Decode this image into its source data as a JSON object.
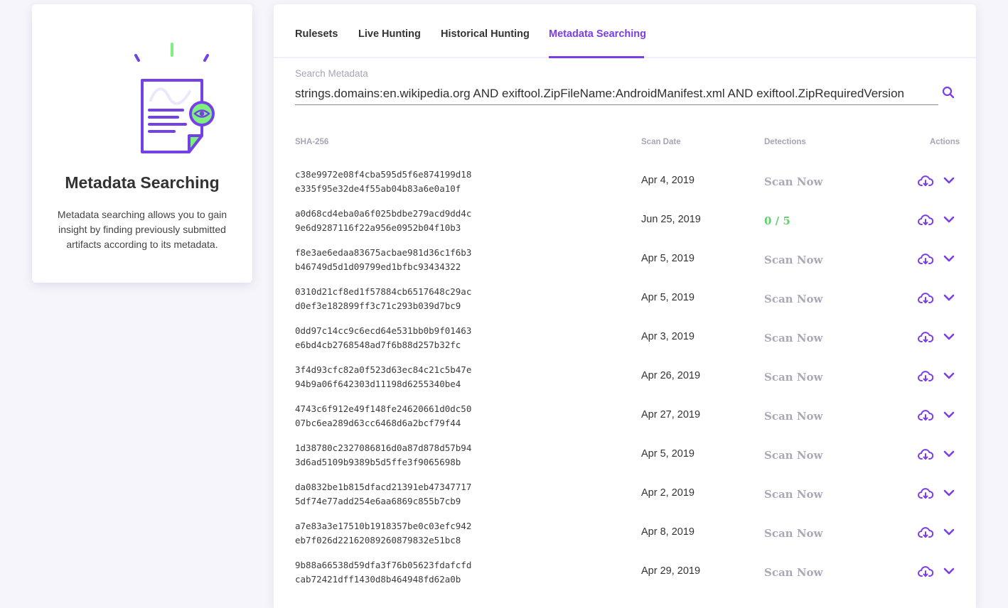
{
  "sidebar": {
    "title": "Metadata Searching",
    "description": "Metadata searching allows you to gain insight by finding previously submitted artifacts according to its metadata.",
    "illustration_icon": "document-eye-icon"
  },
  "tabs": [
    {
      "label": "Rulesets",
      "active": false
    },
    {
      "label": "Live Hunting",
      "active": false
    },
    {
      "label": "Historical Hunting",
      "active": false
    },
    {
      "label": "Metadata Searching",
      "active": true
    }
  ],
  "search": {
    "label": "Search Metadata",
    "value": "strings.domains:en.wikipedia.org AND exiftool.ZipFileName:AndroidManifest.xml AND exiftool.ZipRequiredVersion",
    "icon": "search-icon"
  },
  "table": {
    "headers": {
      "sha": "SHA-256",
      "date": "Scan Date",
      "detections": "Detections",
      "actions": "Actions"
    },
    "rows": [
      {
        "sha1": "c38e9972e08f4cba595d5f6e874199d18",
        "sha2": "e335f95e32de4f55ab04b83a6e0a10f",
        "date": "Apr 4, 2019",
        "detections": "Scan Now",
        "type": "scan"
      },
      {
        "sha1": "a0d68cd4eba0a6f025bdbe279acd9dd4c",
        "sha2": "9e6d9287116f22a956e0952b04f10b3",
        "date": "Jun 25, 2019",
        "detections": "0 / 5",
        "type": "score"
      },
      {
        "sha1": "f8e3ae6edaa83675acbae981d36c1f6b3",
        "sha2": "b46749d5d1d09799ed1bfbc93434322",
        "date": "Apr 5, 2019",
        "detections": "Scan Now",
        "type": "scan"
      },
      {
        "sha1": "0310d21cf8ed1f57884cb6517648c29ac",
        "sha2": "d0ef3e182899ff3c71c293b039d7bc9",
        "date": "Apr 5, 2019",
        "detections": "Scan Now",
        "type": "scan"
      },
      {
        "sha1": "0dd97c14cc9c6ecd64e531bb0b9f01463",
        "sha2": "e6bd4cb2768548ad7f6b88d257b32fc",
        "date": "Apr 3, 2019",
        "detections": "Scan Now",
        "type": "scan"
      },
      {
        "sha1": "3f4d93cfc82a0f523d63ec84c21c5b47e",
        "sha2": "94b9a06f642303d11198d6255340be4",
        "date": "Apr 26, 2019",
        "detections": "Scan Now",
        "type": "scan"
      },
      {
        "sha1": "4743c6f912e49f148fe24620661d0dc50",
        "sha2": "07bc6ea289d63cc6468d6a2bcf79f44",
        "date": "Apr 27, 2019",
        "detections": "Scan Now",
        "type": "scan"
      },
      {
        "sha1": "1d38780c2327086816d0a87d878d57b94",
        "sha2": "3d6ad5109b9389b5d5ffe3f9065698b",
        "date": "Apr 5, 2019",
        "detections": "Scan Now",
        "type": "scan"
      },
      {
        "sha1": "da0832be1b815dfacd21391eb47347717",
        "sha2": "5df74e77add254e6aa6869c855b7cb9",
        "date": "Apr 2, 2019",
        "detections": "Scan Now",
        "type": "scan"
      },
      {
        "sha1": "a7e83a3e17510b1918357be0c03efc942",
        "sha2": "eb7f026d22162089260879832e51bc8",
        "date": "Apr 8, 2019",
        "detections": "Scan Now",
        "type": "scan"
      },
      {
        "sha1": "9b88a66538d59dfa3f76b05623fdafcfd",
        "sha2": "cab72421dff1430d8b464948fd62a0b",
        "date": "Apr 29, 2019",
        "detections": "Scan Now",
        "type": "scan"
      }
    ],
    "row_actions": {
      "download": "cloud-download-icon",
      "expand": "chevron-down-icon"
    }
  },
  "colors": {
    "accent": "#7a3ee8",
    "success": "#5ed16e",
    "muted": "#aba8b7",
    "illustration_green": "#7df07d"
  }
}
